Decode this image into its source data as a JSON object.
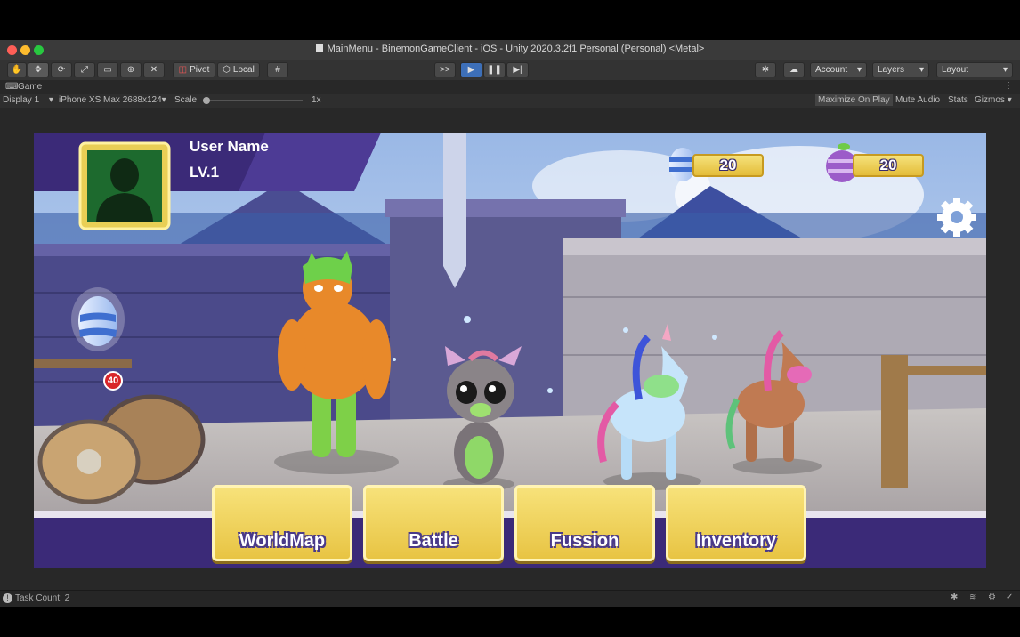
{
  "window": {
    "title": "MainMenu - BinemonGameClient - iOS - Unity 2020.3.2f1 Personal (Personal) <Metal>",
    "colors": {
      "close": "#ff5f57",
      "minimize": "#febc2e",
      "zoom": "#28c840"
    }
  },
  "toolbar": {
    "pivot_label": "Pivot",
    "local_label": "Local",
    "collab_label": ">>",
    "account_label": "Account",
    "layers_label": "Layers",
    "layout_label": "Layout"
  },
  "game_panel": {
    "tab_label": "Game",
    "display_label": "Display 1",
    "resolution_label": "iPhone XS Max 2688x124",
    "scale_label": "Scale",
    "scale_value": "1x",
    "scale_level": 0.0,
    "maximize_label": "Maximize On Play",
    "mute_label": "Mute Audio",
    "stats_label": "Stats",
    "gizmos_label": "Gizmos"
  },
  "status": {
    "task_count": "Task Count: 2"
  },
  "hud": {
    "user_name": "User Name",
    "level": "LV.1",
    "egg_count": "20",
    "fruit_count": "20",
    "egg_badge": "40",
    "accent_purple": "#3b2a78",
    "accent_gold": "#e8c443"
  },
  "menu": [
    {
      "label": "WorldMap",
      "icon": "globe-icon"
    },
    {
      "label": "Battle",
      "icon": "crossed-swords-icon"
    },
    {
      "label": "Fussion",
      "icon": "atom-icon"
    },
    {
      "label": "Inventory",
      "icon": "backpack-icon"
    }
  ]
}
